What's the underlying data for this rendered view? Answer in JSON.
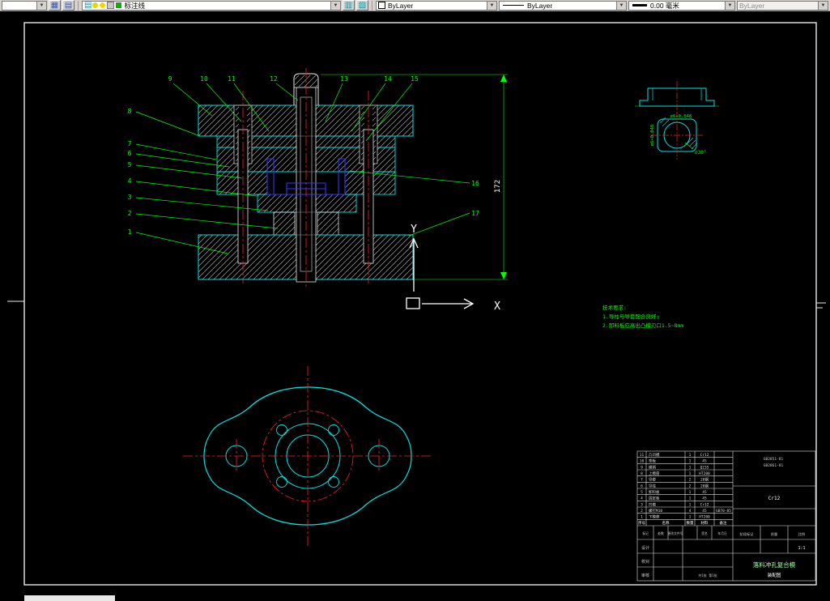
{
  "toolbar": {
    "layer_name": "标注线",
    "color_value": "ByLayer",
    "linetype_value": "ByLayer",
    "lineweight_value": "0.00 毫米",
    "plot_style_value": "ByLayer"
  },
  "drawing": {
    "callouts": [
      "1",
      "2",
      "3",
      "4",
      "5",
      "6",
      "7",
      "8",
      "9",
      "10",
      "11",
      "12",
      "13",
      "14",
      "15",
      "16",
      "17"
    ],
    "dim_height": "172",
    "ucs": {
      "x": "X",
      "y": "Y"
    },
    "detail": {
      "dim_left": "⌀6+0.048",
      "dim_top": "⌀6+0.048",
      "dim_angle": "⌀30°"
    },
    "notes": {
      "title": "技术要求:",
      "line1": "1.导柱与导套配合良好;",
      "line2": "2.卸料板应高出凸模刃口1.5~8mm"
    }
  },
  "bom": {
    "headers": [
      "序号",
      "名称",
      "数量",
      "材料",
      "备注"
    ],
    "rows": [
      [
        "11",
        "凸凹模",
        "1",
        "Cr12",
        ""
      ],
      [
        "10",
        "垫板",
        "1",
        "45",
        ""
      ],
      [
        "9",
        "模柄",
        "1",
        "Q235",
        ""
      ],
      [
        "8",
        "上模座",
        "1",
        "HT200",
        ""
      ],
      [
        "7",
        "导套",
        "2",
        "20钢",
        ""
      ],
      [
        "6",
        "导柱",
        "2",
        "20钢",
        ""
      ],
      [
        "5",
        "卸料板",
        "1",
        "45",
        ""
      ],
      [
        "4",
        "固定板",
        "1",
        "45",
        ""
      ],
      [
        "3",
        "凹模",
        "1",
        "Cr12",
        ""
      ],
      [
        "2",
        "螺钉M10",
        "4",
        "45",
        "GB70-85"
      ],
      [
        "1",
        "下模座",
        "1",
        "HT200",
        ""
      ]
    ]
  },
  "title_block": {
    "title": "落料冲孔复合模",
    "subtitle": "装配图",
    "material": "Cr12",
    "std1": "GB2851-81",
    "std2": "GB2861-81",
    "rev_labels": [
      "标记",
      "处数",
      "更改文件号",
      "签名",
      "年月日"
    ],
    "sign_labels": [
      "设计",
      "校对",
      "审核"
    ],
    "stage_label": "阶段标记",
    "weight_label": "质量",
    "scale_label": "比例",
    "scale_value": "1:1",
    "sheet_info": "共1张 第1张"
  }
}
